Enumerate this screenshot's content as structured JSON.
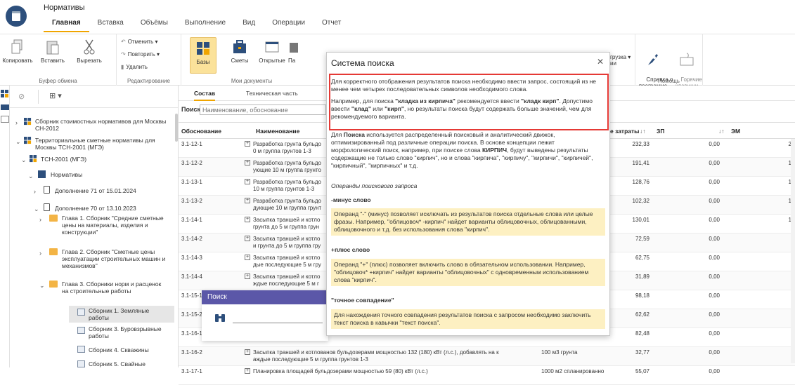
{
  "app": {
    "title": "Нормативы"
  },
  "tabs": [
    {
      "label": "Главная"
    },
    {
      "label": "Вставка"
    },
    {
      "label": "Объёмы"
    },
    {
      "label": "Выполнение"
    },
    {
      "label": "Вид"
    },
    {
      "label": "Операции"
    },
    {
      "label": "Отчет"
    }
  ],
  "ribbon": {
    "clipboard": {
      "copy": "Копировать",
      "paste": "Вставить",
      "cut": "Вырезать",
      "label": "Буфер обмена"
    },
    "edit": {
      "undo": "Отменить",
      "redo": "Повторить",
      "delete": "Удалить",
      "label": "Редактирование"
    },
    "mydocs": {
      "bases": "Базы",
      "estimates": "Сметы",
      "open": "Открытые",
      "label": "Мои документы",
      "pa": "Па"
    },
    "load": "грузка ▾\nии",
    "help": {
      "about": "Справка о\nпрограмме",
      "hotkeys": "Горячие\nклавиши",
      "label": "Помощь"
    }
  },
  "tree": {
    "nodes": [
      {
        "label": "Сборник стоимостных нормативов для Москвы СН-2012"
      },
      {
        "label": "Территориальные сметные нормативы для Москвы ТСН-2001 (МГЭ)"
      },
      {
        "label": "ТСН-2001 (МГЭ)"
      },
      {
        "label": "Нормативы"
      },
      {
        "label": "Дополнение 71 от 15.01.2024"
      },
      {
        "label": "Дополнение 70 от 13.10.2023"
      },
      {
        "label": "Глава 1. Сборник \"Средние сметные цены на материалы, изделия и конструкции\""
      },
      {
        "label": "Глава 2. Сборник \"Сметные цены эксплуатации строительных машин и механизмов\""
      },
      {
        "label": "Глава  3. Сборники норм и расценок на строительные работы"
      },
      {
        "label": "Сборник 1. Земляные работы"
      },
      {
        "label": "Сборник 3. Буровзрывные работы"
      },
      {
        "label": "Сборник 4. Скважины"
      },
      {
        "label": "Сборник 5. Свайные"
      }
    ]
  },
  "main": {
    "subtabs": [
      {
        "label": "Состав"
      },
      {
        "label": "Техническая часть"
      }
    ],
    "search_label": "Поиск",
    "search_placeholder": "Наименование, обоснование",
    "columns": {
      "code": "Обоснование",
      "name": "Наименование",
      "cost": "е затраты",
      "zp": "ЗП",
      "em": "ЭМ"
    },
    "rows": [
      {
        "code": "3.1-12-1",
        "name": "Разработка грунта бульдо\n0 м группа грунтов 1-3",
        "cost": "232,33",
        "zp": "0,00",
        "em": "2"
      },
      {
        "code": "3.1-12-2",
        "name": "Разработка грунта бульдо\nующие 10 м группа грунто",
        "cost": "191,41",
        "zp": "0,00",
        "em": "1"
      },
      {
        "code": "3.1-13-1",
        "name": "Разработка грунта бульдо\n10 м группа грунтов 1-3",
        "cost": "128,76",
        "zp": "0,00",
        "em": "1"
      },
      {
        "code": "3.1-13-2",
        "name": "Разработка грунта бульдо\nдующие 10 м группа грунт",
        "cost": "102,32",
        "zp": "0,00",
        "em": "1"
      },
      {
        "code": "3.1-14-1",
        "name": "Засыпка траншей и котло\nгрунта до 5 м группа грун",
        "cost": "130,01",
        "zp": "0,00",
        "em": "1"
      },
      {
        "code": "3.1-14-2",
        "name": "Засыпка траншей и котло\nи грунта до 5 м группа гру",
        "cost": "72,59",
        "zp": "0,00",
        "em": ""
      },
      {
        "code": "3.1-14-3",
        "name": "Засыпка траншей и котло\nдые последующие 5 м гру",
        "cost": "62,75",
        "zp": "0,00",
        "em": ""
      },
      {
        "code": "3.1-14-4",
        "name": "Засыпка траншей и котло\nждые последующие 5 м г",
        "cost": "31,89",
        "zp": "0,00",
        "em": ""
      },
      {
        "code": "3.1-15-1",
        "name": "Засыпка траншей и котло",
        "cost": "98,18",
        "zp": "0,00",
        "em": ""
      },
      {
        "code": "3.1-15-2",
        "name": "",
        "cost": "62,62",
        "zp": "0,00",
        "em": ""
      },
      {
        "code": "3.1-16-1",
        "name": "",
        "cost": "82,48",
        "zp": "0,00",
        "em": ""
      },
      {
        "code": "3.1-16-2",
        "name": "Засыпка траншей и котлованов бульдозерами мощностью 132 (180) кВт (л.с.), добавлять на к\nаждые последующие 5 м группа грунтов 1-3",
        "unit": "100 м3 грунта",
        "cost": "32,77",
        "zp": "0,00",
        "em": ""
      },
      {
        "code": "3.1-17-1",
        "name": "Планировка площадей бульдозерами мощностью 59 (80) кВт (л.с.)",
        "unit": "1000 м2 спланированно",
        "cost": "55,07",
        "zp": "0,00",
        "em": ""
      }
    ]
  },
  "mini_dialog": {
    "title": "Поиск"
  },
  "modal": {
    "title": "Система поиска",
    "p1": "Для корректного отображения результатов поиска необходимо ввести запрос, состоящий из не менее чем четырех последовательных символов необходимого слова.",
    "p2a": "Например, для поиска ",
    "p2b": "\"кладка из кирпича\"",
    "p2c": " рекомендуется ввести ",
    "p2d": "\"кладк кирп\"",
    "p2e": ". Допустимо ввести ",
    "p2f": "\"клад\"",
    "p2g": " или ",
    "p2h": "\"кирп\"",
    "p2i": ", но результаты поиска будут содержать больше значений, чем для рекомендуемого варианта.",
    "p3a": "Для ",
    "p3b": "Поиска",
    "p3c": " используется распределенный поисковый и аналитический движок, оптимизированный под различные операции поиска. В основе концепции лежит морфологический поиск, например, при поиске слова ",
    "p3d": "КИРПИЧ",
    "p3e": ", будут выведены результаты содержащие не только слово \"кирпич\", но и слова \"кирпича\", \"кирпичу\", \"кирпичи\", \"кирпичей\", \"кирпичный\", \"кирпичных\" и т.д.",
    "operands": "Операнды поискового запроса",
    "minus_title": "-минус слово",
    "minus_text": "Операнд \"-\" (минус) позволяет исключать из результатов поиска отдельные слова или целые фразы. Например, \"облицовоч* -кирпич\" найдет варианты облицовочных, облицованными, облицовочного и т.д. без использования слова \"кирпич\".",
    "plus_title": "+плюс слово",
    "plus_text": "Операнд \"+\" (плюс) позволяет включить слово в обязательном использовании. Например, \"облицовоч* +кирпич\" найдет варианты \"облицовочных\" с одновременным использованием слова \"кирпич\".",
    "exact_title": "\"точное совпадение\"",
    "exact_text": "Для нахождения точного совпадения результатов поиска с запросом необходимо заключить текст поиска в кавычки \"текст поиска\"."
  }
}
